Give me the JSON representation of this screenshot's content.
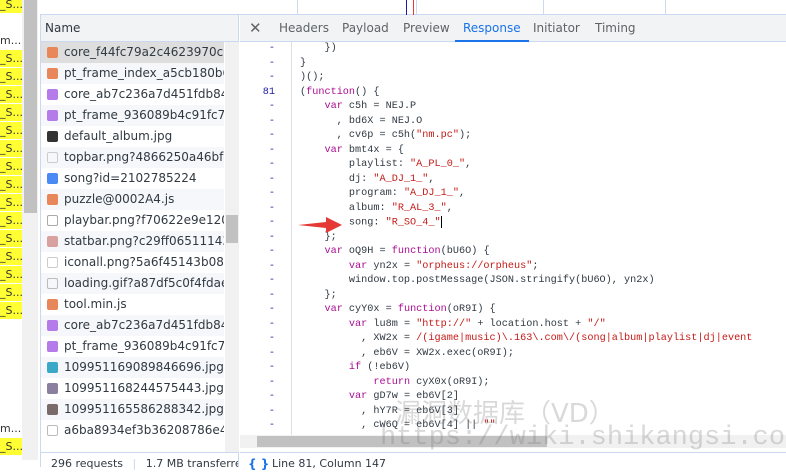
{
  "left_column": {
    "cells": [
      "_S...",
      "",
      "m...",
      "_S...",
      "_S...",
      "_S...",
      "_S...",
      "_S...",
      "_S...",
      "_S...",
      "_S...",
      "_S...",
      "_S...",
      "_S...",
      "_S...",
      "_S...",
      "_S...",
      "_S...",
      "",
      "",
      "",
      "",
      "",
      "m...",
      "_S..."
    ]
  },
  "name_panel": {
    "header": "Name",
    "rows": [
      {
        "name": "core_f44fc79a2c4623970ca5...",
        "icon": "js-icon",
        "color": "#e8875a",
        "selected": true
      },
      {
        "name": "pt_frame_index_a5cb180b6...",
        "icon": "js-icon",
        "color": "#e8875a"
      },
      {
        "name": "core_ab7c236a7d451fdb84...",
        "icon": "css-icon",
        "color": "#b57be8"
      },
      {
        "name": "pt_frame_936089b4c91fc7f6...",
        "icon": "css-icon",
        "color": "#b57be8"
      },
      {
        "name": "default_album.jpg",
        "icon": "image-icon",
        "color": "#333333"
      },
      {
        "name": "topbar.png?4866250a46bfc...",
        "icon": "image-icon",
        "color": "#cccccc"
      },
      {
        "name": "song?id=2102785224",
        "icon": "document-icon",
        "color": "#4a8af4"
      },
      {
        "name": "puzzle@0002A4.js",
        "icon": "js-icon",
        "color": "#e8875a"
      },
      {
        "name": "playbar.png?f70622e9e1205...",
        "icon": "image-icon",
        "color": "#aaaaaa"
      },
      {
        "name": "statbar.png?c29ff06511143...",
        "icon": "image-icon",
        "color": "#d9a0a0"
      },
      {
        "name": "iconall.png?5a6f45143b08a...",
        "icon": "image-icon",
        "color": "#cccccc"
      },
      {
        "name": "loading.gif?a87df5c0f4fdae...",
        "icon": "image-icon",
        "color": "#bbbbbb"
      },
      {
        "name": "tool.min.js",
        "icon": "js-icon",
        "color": "#e8875a"
      },
      {
        "name": "core_ab7c236a7d451fdb84...",
        "icon": "css-icon",
        "color": "#b57be8"
      },
      {
        "name": "pt_frame_936089b4c91fc7f6...",
        "icon": "css-icon",
        "color": "#b57be8"
      },
      {
        "name": "109951169089846696.jpg?p...",
        "icon": "image-icon",
        "color": "#3ba8c8"
      },
      {
        "name": "109951168244575443.jpg?p...",
        "icon": "image-icon",
        "color": "#8a7fa0"
      },
      {
        "name": "109951165586288342.jpg?p...",
        "icon": "image-icon",
        "color": "#7a6a6a"
      },
      {
        "name": "a6ba8934ef3b36208786e44...",
        "icon": "file-icon",
        "color": "#bbbbbb"
      }
    ],
    "footer": {
      "requests": "296 requests",
      "transferred": "1.7 MB transferred"
    }
  },
  "detail_panel": {
    "tabs": [
      {
        "label": "Headers"
      },
      {
        "label": "Payload"
      },
      {
        "label": "Preview"
      },
      {
        "label": "Response",
        "active": true
      },
      {
        "label": "Initiator"
      },
      {
        "label": "Timing"
      }
    ],
    "code_lines": [
      {
        "n": "-",
        "t": [
          [
            "    })",
            "p"
          ]
        ]
      },
      {
        "n": "-",
        "t": [
          [
            "}",
            "p"
          ]
        ]
      },
      {
        "n": "-",
        "t": [
          [
            ")();",
            "p"
          ]
        ]
      },
      {
        "n": "81",
        "t": [
          [
            "(",
            "p"
          ],
          [
            "function",
            "k"
          ],
          [
            "() {",
            "p"
          ]
        ]
      },
      {
        "n": "-",
        "t": [
          [
            "    ",
            "p"
          ],
          [
            "var",
            "k"
          ],
          [
            " c5h = NEJ.P",
            "p"
          ]
        ]
      },
      {
        "n": "-",
        "t": [
          [
            "      , bd6X = NEJ.O",
            "p"
          ]
        ]
      },
      {
        "n": "-",
        "t": [
          [
            "      , cv6p = c5h(",
            "p"
          ],
          [
            "\"nm.pc\"",
            "s"
          ],
          [
            ");",
            "p"
          ]
        ]
      },
      {
        "n": "-",
        "t": [
          [
            "    ",
            "p"
          ],
          [
            "var",
            "k"
          ],
          [
            " bmt4x = {",
            "p"
          ]
        ]
      },
      {
        "n": "-",
        "t": [
          [
            "        playlist: ",
            "p"
          ],
          [
            "\"A_PL_0_\"",
            "s"
          ],
          [
            ",",
            "p"
          ]
        ]
      },
      {
        "n": "-",
        "t": [
          [
            "        dj: ",
            "p"
          ],
          [
            "\"A_DJ_1_\"",
            "s"
          ],
          [
            ",",
            "p"
          ]
        ]
      },
      {
        "n": "-",
        "t": [
          [
            "        program: ",
            "p"
          ],
          [
            "\"A_DJ_1_\"",
            "s"
          ],
          [
            ",",
            "p"
          ]
        ]
      },
      {
        "n": "-",
        "t": [
          [
            "        album: ",
            "p"
          ],
          [
            "\"R_AL_3_\"",
            "s"
          ],
          [
            ",",
            "p"
          ]
        ]
      },
      {
        "n": "-",
        "t": [
          [
            "        song: ",
            "p"
          ],
          [
            "\"R_SO_4_\"",
            "s"
          ]
        ],
        "cursor": true
      },
      {
        "n": "-",
        "t": [
          [
            "    };",
            "p"
          ]
        ]
      },
      {
        "n": "-",
        "t": [
          [
            "    ",
            "p"
          ],
          [
            "var",
            "k"
          ],
          [
            " oQ9H = ",
            "p"
          ],
          [
            "function",
            "k"
          ],
          [
            "(bU6O) {",
            "p"
          ]
        ]
      },
      {
        "n": "-",
        "t": [
          [
            "        ",
            "p"
          ],
          [
            "var",
            "k"
          ],
          [
            " yn2x = ",
            "p"
          ],
          [
            "\"orpheus://orpheus\"",
            "s"
          ],
          [
            ";",
            "p"
          ]
        ]
      },
      {
        "n": "-",
        "t": [
          [
            "        window.top.postMessage(JSON.stringify(bU6O), yn2x)",
            "p"
          ]
        ]
      },
      {
        "n": "-",
        "t": [
          [
            "    };",
            "p"
          ]
        ]
      },
      {
        "n": "-",
        "t": [
          [
            "    ",
            "p"
          ],
          [
            "var",
            "k"
          ],
          [
            " cyY0x = ",
            "p"
          ],
          [
            "function",
            "k"
          ],
          [
            "(oR9I) {",
            "p"
          ]
        ]
      },
      {
        "n": "-",
        "t": [
          [
            "        ",
            "p"
          ],
          [
            "var",
            "k"
          ],
          [
            " lu8m = ",
            "p"
          ],
          [
            "\"http://\"",
            "s"
          ],
          [
            " + location.host + ",
            "p"
          ],
          [
            "\"/\"",
            "s"
          ]
        ]
      },
      {
        "n": "-",
        "t": [
          [
            "          , XW2x = ",
            "p"
          ],
          [
            "/(igame|music)\\.163\\.com\\/(song|album|playlist|dj|event",
            "s"
          ]
        ]
      },
      {
        "n": "-",
        "t": [
          [
            "          , eb6V = XW2x.exec(oR9I);",
            "p"
          ]
        ]
      },
      {
        "n": "-",
        "t": [
          [
            "        ",
            "p"
          ],
          [
            "if",
            "k"
          ],
          [
            " (!eb6V)",
            "p"
          ]
        ]
      },
      {
        "n": "-",
        "t": [
          [
            "            ",
            "p"
          ],
          [
            "return",
            "k"
          ],
          [
            " cyX0x(oR9I);",
            "p"
          ]
        ]
      },
      {
        "n": "-",
        "t": [
          [
            "        ",
            "p"
          ],
          [
            "var",
            "k"
          ],
          [
            " gD7w = eb6V[2]",
            "p"
          ]
        ]
      },
      {
        "n": "-",
        "t": [
          [
            "          , hY7R = eb6V[3]",
            "p"
          ]
        ]
      },
      {
        "n": "-",
        "t": [
          [
            "          , cW6Q = eb6V[4] || ",
            "p"
          ],
          [
            "\"\"",
            "s"
          ]
        ]
      }
    ],
    "status": "Line 81, Column 147"
  },
  "watermark": {
    "line1": "漏洞数据库（VD）",
    "line2": "https://wiki.shikangsi.com"
  },
  "colors": {
    "accent": "#1a73e8",
    "keyword": "#aa0d91",
    "string": "#c41a16",
    "highlight": "#ffff33",
    "arrow": "#e53935"
  }
}
